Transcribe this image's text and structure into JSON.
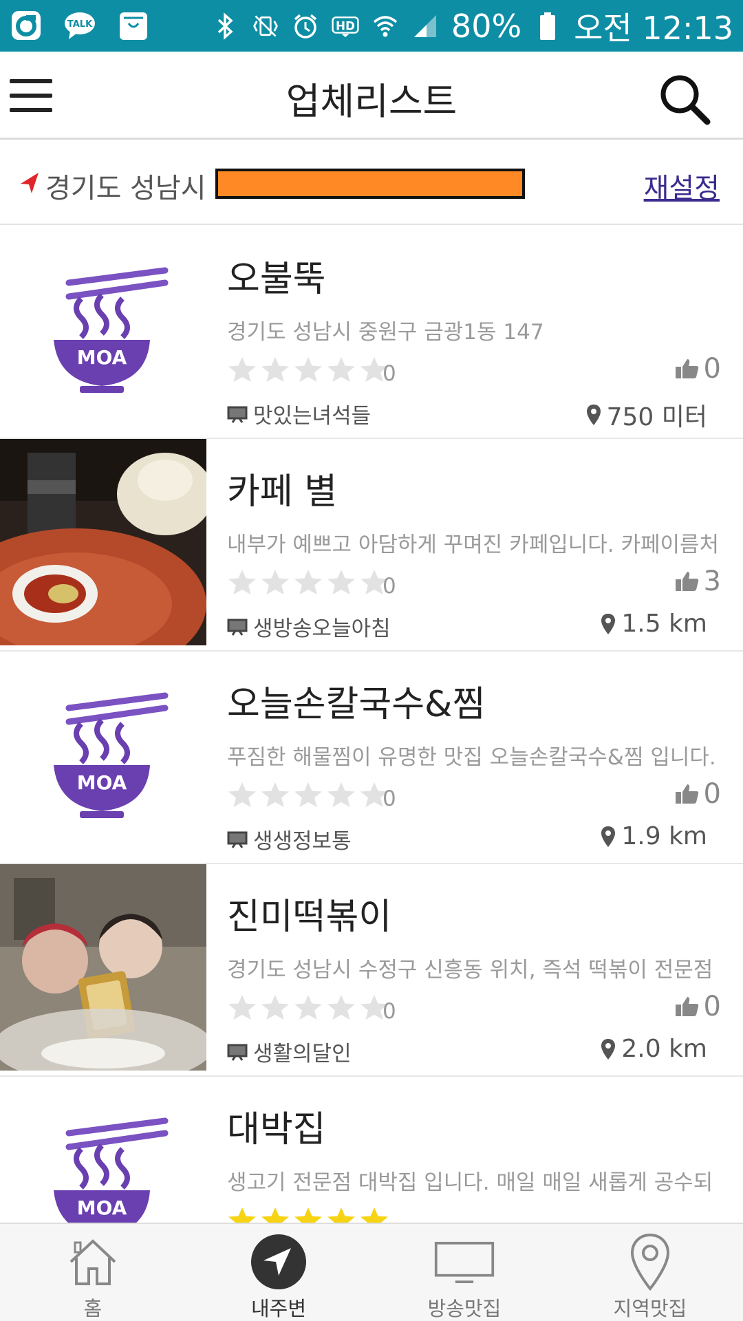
{
  "status_bar": {
    "battery": "80%",
    "time": "오전 12:13",
    "left_icons": [
      "ollehtv-icon",
      "kakaotalk-icon",
      "shopping-bag-icon"
    ],
    "right_icons": [
      "bluetooth-icon",
      "vibrate-icon",
      "alarm-icon",
      "hd-icon",
      "wifi-icon",
      "signal-icon",
      "battery-icon"
    ],
    "background": "#0e8ea4"
  },
  "header": {
    "title": "업체리스트",
    "menu_icon": "hamburger-menu-icon",
    "search_icon": "search-icon"
  },
  "location": {
    "text": "경기도 성남시",
    "redacted_color": "#ff8a25",
    "reset_label": "재설정",
    "arrow_color": "#e0262b"
  },
  "stores": [
    {
      "name": "오불뚝",
      "description": "경기도 성남시 중원구 금광1동 147",
      "rating": "0",
      "stars": 0,
      "likes": "0",
      "show": "맛있는녀석들",
      "distance": "750 미터",
      "thumbnail": "logo"
    },
    {
      "name": "카페 별",
      "description": "내부가 예쁘고 아담하게 꾸며진 카페입니다. 카페이름처",
      "rating": "0",
      "stars": 0,
      "likes": "3",
      "show": "생방송오늘아침",
      "distance": "1.5 km",
      "thumbnail": "photo-cafe"
    },
    {
      "name": "오늘손칼국수&찜",
      "description": "푸짐한 해물찜이 유명한 맛집 오늘손칼국수&찜 입니다.",
      "rating": "0",
      "stars": 0,
      "likes": "0",
      "show": "생생정보통",
      "distance": "1.9 km",
      "thumbnail": "logo"
    },
    {
      "name": "진미떡볶이",
      "description": "경기도 성남시 수정구 신흥동 위치, 즉석 떡볶이 전문점",
      "rating": "0",
      "stars": 0,
      "likes": "0",
      "show": "생활의달인",
      "distance": "2.0 km",
      "thumbnail": "photo-tteok"
    },
    {
      "name": "대박집",
      "description": "생고기 전문점 대박집 입니다. 매일 매일 새롭게 공수되",
      "rating": "",
      "stars": 5,
      "likes": "",
      "show": "",
      "distance": "",
      "thumbnail": "logo"
    }
  ],
  "bottom_nav": [
    {
      "label": "홈",
      "icon": "home-icon",
      "active": false
    },
    {
      "label": "내주변",
      "icon": "nearby-arrow-icon",
      "active": true
    },
    {
      "label": "방송맛집",
      "icon": "tv-icon",
      "active": false
    },
    {
      "label": "지역맛집",
      "icon": "map-pin-icon",
      "active": false
    }
  ],
  "colors": {
    "logo_purple": "#6a3fb0",
    "star_empty": "#e2e2e2",
    "star_filled": "#f6d313",
    "link": "#3b2b8f"
  }
}
